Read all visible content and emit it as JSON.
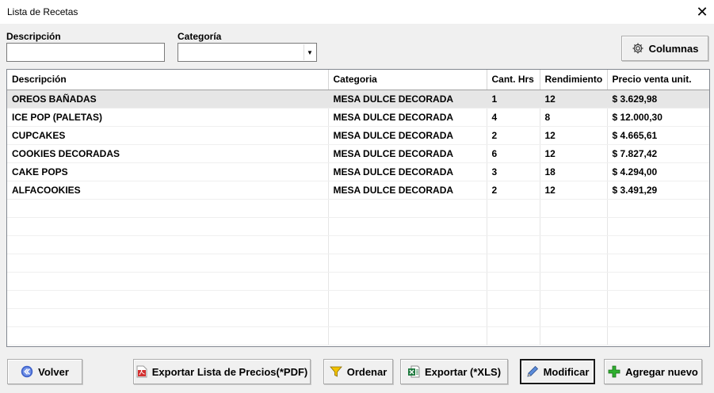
{
  "window": {
    "title": "Lista de Recetas",
    "close_symbol": "✕"
  },
  "filters": {
    "descripcion_label": "Descripción",
    "descripcion_value": "",
    "categoria_label": "Categoría",
    "categoria_value": ""
  },
  "toolbar": {
    "columnas_label": "Columnas"
  },
  "table": {
    "columns": [
      "Descripción",
      "Categoria",
      "Cant. Hrs",
      "Rendimiento",
      "Precio venta unit."
    ],
    "rows": [
      [
        "OREOS BAÑADAS",
        "MESA DULCE DECORADA",
        "1",
        "12",
        "$ 3.629,98"
      ],
      [
        "ICE POP (PALETAS)",
        "MESA DULCE DECORADA",
        "4",
        "8",
        "$ 12.000,30"
      ],
      [
        "CUPCAKES",
        "MESA DULCE DECORADA",
        "2",
        "12",
        "$ 4.665,61"
      ],
      [
        "COOKIES DECORADAS",
        "MESA DULCE DECORADA",
        "6",
        "12",
        "$ 7.827,42"
      ],
      [
        "CAKE POPS",
        "MESA DULCE DECORADA",
        "3",
        "18",
        "$ 4.294,00"
      ],
      [
        "ALFACOOKIES",
        "MESA DULCE DECORADA",
        "2",
        "12",
        "$ 3.491,29"
      ]
    ],
    "selected_row": 0
  },
  "buttons": {
    "volver": "Volver",
    "exportar_pdf": "Exportar Lista de Precios(*PDF)",
    "ordenar": "Ordenar",
    "exportar_xls": "Exportar (*XLS)",
    "modificar": "Modificar",
    "agregar": "Agregar nuevo"
  },
  "colors": {
    "selected_row": "#e6e6e6",
    "volver_icon": "#3b5fc9",
    "pdf_icon": "#d32f2f",
    "funnel_icon": "#f2c200",
    "xls_icon": "#1f7a3f",
    "add_icon": "#2fb12f"
  },
  "icons": {
    "volver": "double-chevron-left-icon",
    "columnas": "gear-icon",
    "pdf": "pdf-file-icon",
    "ordenar": "funnel-icon",
    "xls": "excel-file-icon",
    "modificar": "pencil-icon",
    "agregar": "plus-icon"
  }
}
